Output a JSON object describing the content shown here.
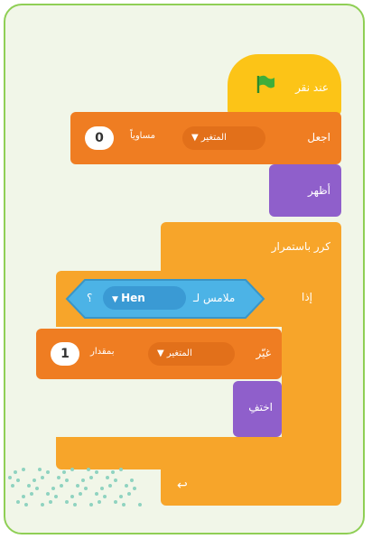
{
  "blocks": {
    "hat": {
      "label": "عند نقر",
      "flag_icon": "green-flag-icon"
    },
    "set_var": {
      "label": "اجعل",
      "var_name": "المتغير",
      "to_label": "مساوياً",
      "value": "0"
    },
    "show": {
      "label": "أظهر"
    },
    "forever": {
      "label": "كرر باستمرار"
    },
    "if_block": {
      "label": "إذا"
    },
    "touching": {
      "label": "ملامس لـ",
      "target": "Hen",
      "suffix": "؟"
    },
    "change_var": {
      "label": "غيّر",
      "var_name": "المتغير",
      "by_label": "بمقدار",
      "value": "1"
    },
    "hide": {
      "label": "اختفِ"
    }
  },
  "colors": {
    "frame_border": "#8fcf55",
    "motion_orange": "#f7a52a",
    "variables_orange": "#ef7d22",
    "events_yellow": "#fcc417",
    "looks_purple": "#8f5fcb",
    "sensing_blue": "#4cb3e6"
  }
}
